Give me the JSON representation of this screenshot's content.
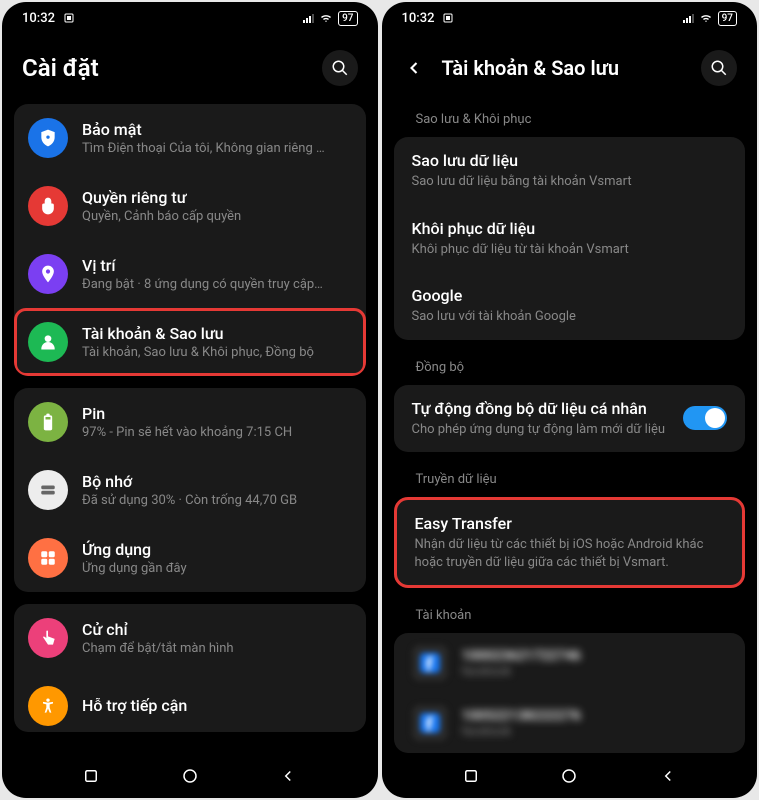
{
  "status": {
    "time": "10:32",
    "battery": "97"
  },
  "left": {
    "title": "Cài đặt",
    "items": [
      {
        "icon": "shield",
        "color": "#1a73e8",
        "title": "Bảo mật",
        "sub": "Tìm Điện thoại Của tôi, Không gian riêng …"
      },
      {
        "icon": "hand",
        "color": "#e53935",
        "title": "Quyền riêng tư",
        "sub": "Quyền, Cảnh báo cấp quyền"
      },
      {
        "icon": "location",
        "color": "#7b3ff2",
        "title": "Vị trí",
        "sub": "Đang bật · 8 ứng dụng có quyền truy cập…"
      },
      {
        "icon": "user",
        "color": "#1db954",
        "title": "Tài khoản & Sao lưu",
        "sub": "Tài khoản, Sao lưu & Khôi phục, Đồng bộ",
        "hl": true
      },
      {
        "icon": "battery",
        "color": "#7cb342",
        "title": "Pin",
        "sub": "97% - Pin sẽ hết vào khoảng 7:15 CH"
      },
      {
        "icon": "storage",
        "color": "#ededed",
        "title": "Bộ nhớ",
        "sub": "Đã sử dụng 30% · Còn trống 44,70 GB"
      },
      {
        "icon": "apps",
        "color": "#ff7043",
        "title": "Ứng dụng",
        "sub": "Ứng dụng gần đây"
      },
      {
        "icon": "gesture",
        "color": "#ec407a",
        "title": "Cử chỉ",
        "sub": "Chạm để bật/tắt màn hình"
      },
      {
        "icon": "access",
        "color": "#ff9800",
        "title": "Hỗ trợ tiếp cận",
        "sub": ""
      }
    ]
  },
  "right": {
    "title": "Tài khoản & Sao lưu",
    "sections": [
      {
        "header": "Sao lưu & Khôi phục",
        "items": [
          {
            "title": "Sao lưu dữ liệu",
            "sub": "Sao lưu dữ liệu bằng tài khoản Vsmart"
          },
          {
            "title": "Khôi phục dữ liệu",
            "sub": "Khôi phục dữ liệu từ tài khoản Vsmart"
          },
          {
            "title": "Google",
            "sub": "Sao lưu với tài khoản Google"
          }
        ]
      },
      {
        "header": "Đồng bộ",
        "items": [
          {
            "title": "Tự động đồng bộ dữ liệu cá nhân",
            "sub": "Cho phép ứng dụng tự động làm mới dữ liệu",
            "toggle": true
          }
        ]
      },
      {
        "header": "Truyền dữ liệu",
        "items": [
          {
            "title": "Easy Transfer",
            "sub": "Nhận dữ liệu từ các thiết bị iOS hoặc Android khác hoặc truyền dữ liệu giữa các thiết bị Vsmart.",
            "hl": true
          }
        ]
      },
      {
        "header": "Tài khoản",
        "accounts": [
          {
            "name": "100023621722746",
            "provider": "facebook"
          },
          {
            "name": "100522138222276",
            "provider": "facebook"
          }
        ]
      }
    ]
  }
}
